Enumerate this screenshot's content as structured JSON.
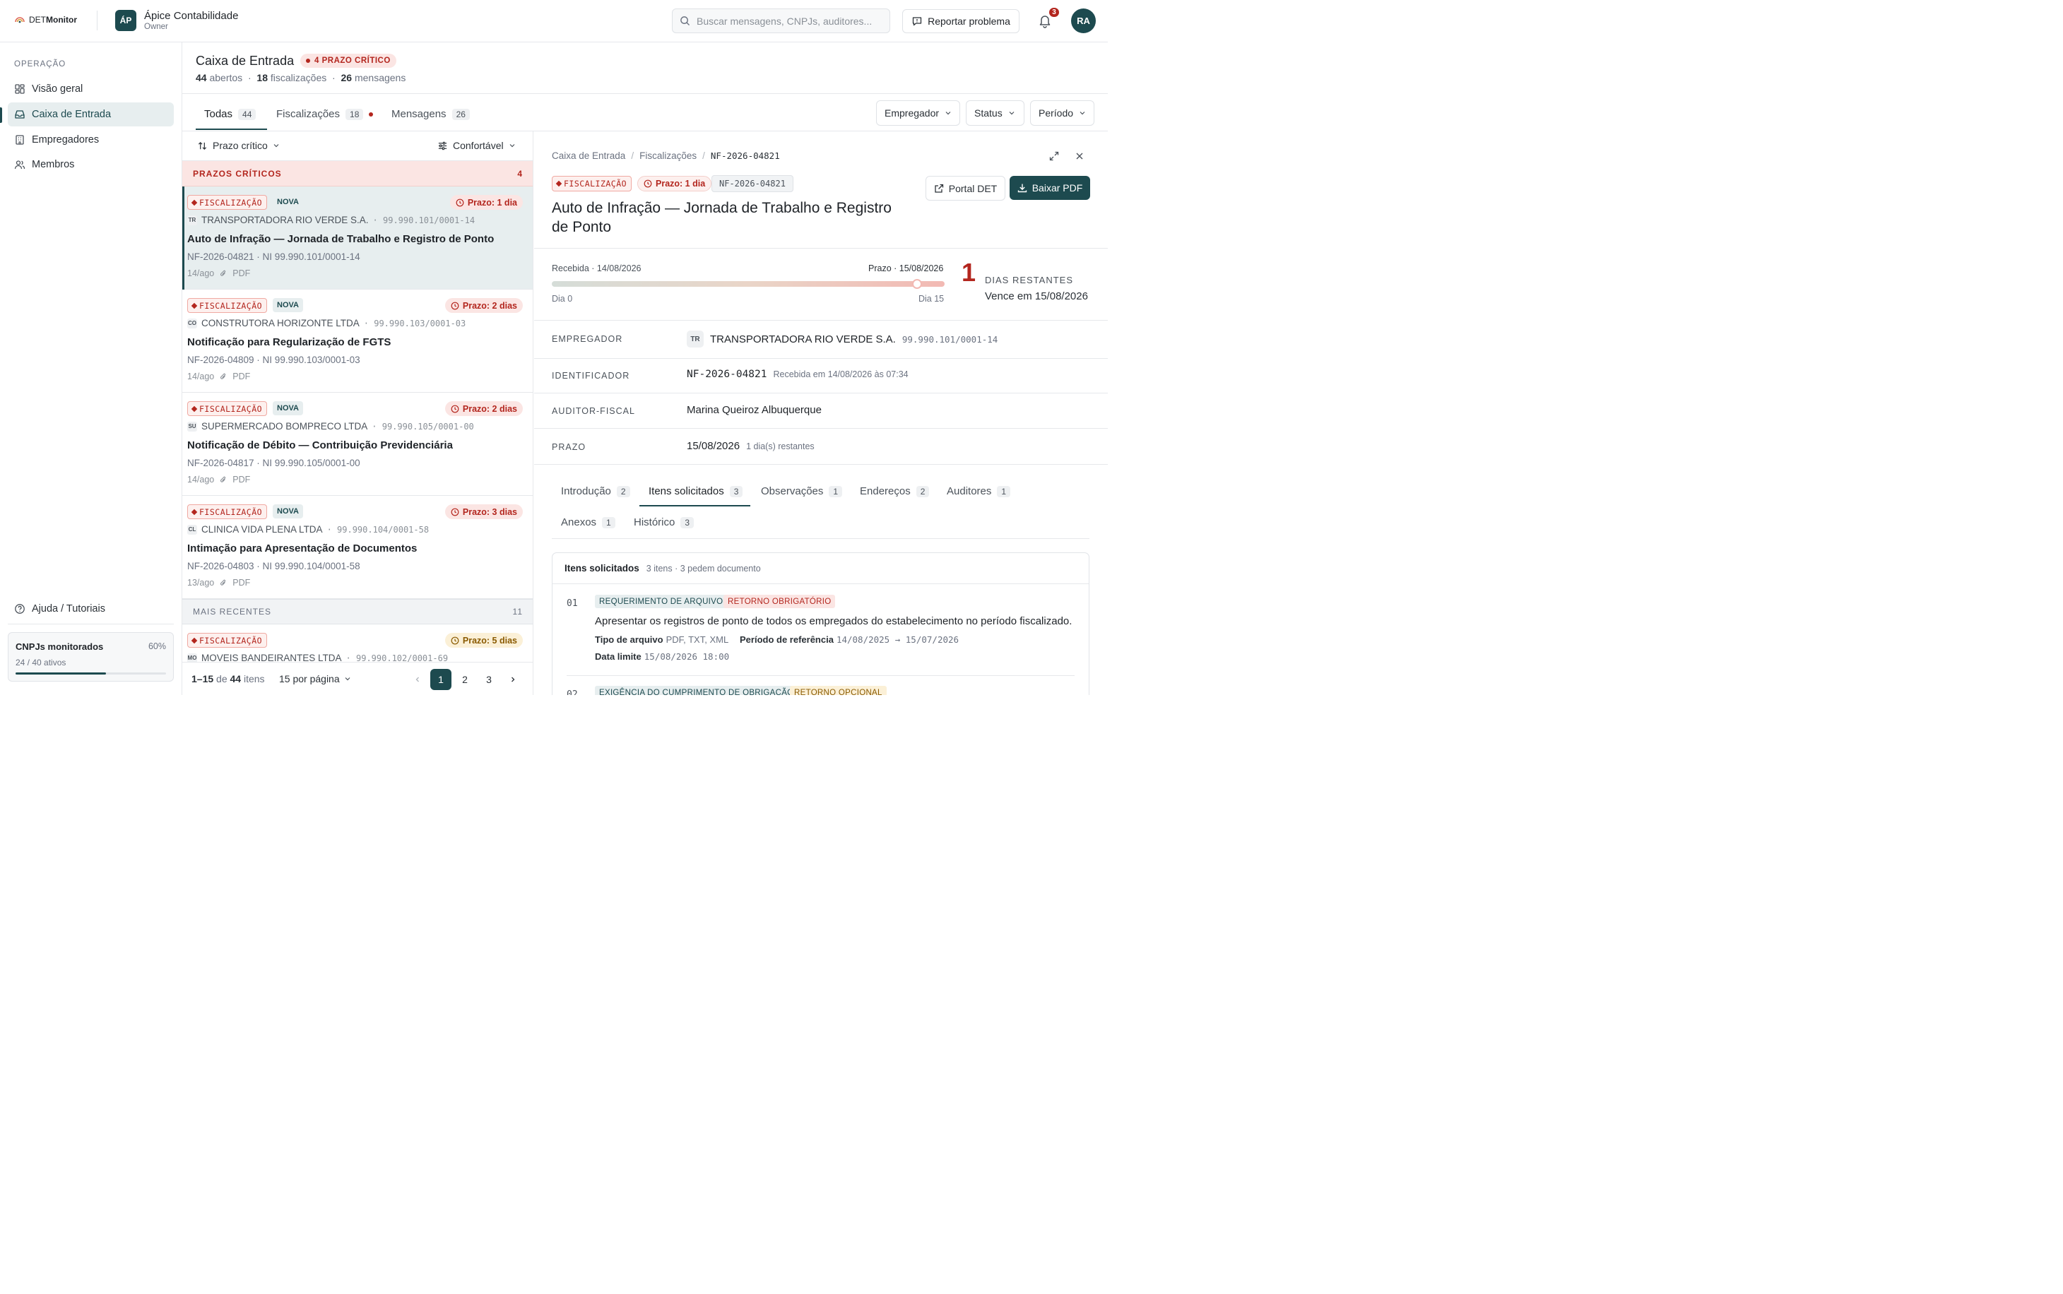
{
  "colors": {
    "brand": "#1d4a4f",
    "danger": "#b3261e",
    "warning": "#8a5a00"
  },
  "app": {
    "logo_light": "DET",
    "logo_bold": "Monitor"
  },
  "org": {
    "initials": "ÁP",
    "name": "Ápice Contabilidade",
    "role": "Owner"
  },
  "search": {
    "placeholder": "Buscar mensagens, CNPJs, auditores..."
  },
  "report_label": "Reportar problema",
  "notifications": {
    "count": "3"
  },
  "user": {
    "initials": "RA"
  },
  "sidebar": {
    "section": "OPERAÇÃO",
    "items": [
      {
        "label": "Visão geral",
        "icon": "grid-icon"
      },
      {
        "label": "Caixa de Entrada",
        "icon": "inbox-icon"
      },
      {
        "label": "Empregadores",
        "icon": "building-icon"
      },
      {
        "label": "Membros",
        "icon": "users-icon"
      }
    ],
    "help": "Ajuda / Tutoriais",
    "cnpj": {
      "title": "CNPJs monitorados",
      "pct": "60%",
      "sub": "24 / 40 ativos",
      "progress": 0.6
    }
  },
  "page": {
    "title": "Caixa de Entrada",
    "crit_badge": "4 PRAZO CRÍTICO",
    "stats": [
      {
        "value": "44",
        "label": "abertos"
      },
      {
        "value": "18",
        "label": "fiscalizações"
      },
      {
        "value": "26",
        "label": "mensagens"
      }
    ],
    "sep": "·"
  },
  "tabs": [
    {
      "label": "Todas",
      "count": "44"
    },
    {
      "label": "Fiscalizações",
      "count": "18"
    },
    {
      "label": "Mensagens",
      "count": "26"
    }
  ],
  "filters": [
    "Empregador",
    "Status",
    "Período"
  ],
  "list": {
    "sort_label": "Prazo crítico",
    "density_label": "Confortável",
    "critical_header": "PRAZOS CRÍTICOS",
    "critical_count": "4",
    "recent_header": "MAIS RECENTES",
    "recent_count": "11",
    "type_label": "FISCALIZAÇÃO",
    "new_label": "NOVA",
    "attach_label": "PDF",
    "items": [
      {
        "emp_initials": "TR",
        "employer": "TRANSPORTADORA RIO VERDE S.A.",
        "cnpj": "· 99.990.101/0001-14",
        "deadline": "Prazo: 1 dia",
        "title": "Auto de Infração — Jornada de Trabalho e Registro de Ponto",
        "ref": "NF-2026-04821 · NI 99.990.101/0001-14",
        "date": "14/ago"
      },
      {
        "emp_initials": "CO",
        "employer": "CONSTRUTORA HORIZONTE LTDA",
        "cnpj": "· 99.990.103/0001-03",
        "deadline": "Prazo: 2 dias",
        "title": "Notificação para Regularização de FGTS",
        "ref": "NF-2026-04809 · NI 99.990.103/0001-03",
        "date": "14/ago"
      },
      {
        "emp_initials": "SU",
        "employer": "SUPERMERCADO BOMPRECO LTDA",
        "cnpj": "· 99.990.105/0001-00",
        "deadline": "Prazo: 2 dias",
        "title": "Notificação de Débito — Contribuição Previdenciária",
        "ref": "NF-2026-04817 · NI 99.990.105/0001-00",
        "date": "14/ago"
      },
      {
        "emp_initials": "CL",
        "employer": "CLINICA VIDA PLENA LTDA",
        "cnpj": "· 99.990.104/0001-58",
        "deadline": "Prazo: 3 dias",
        "title": "Intimação para Apresentação de Documentos",
        "ref": "NF-2026-04803 · NI 99.990.104/0001-58",
        "date": "13/ago"
      }
    ],
    "recent_item": {
      "emp_initials": "MO",
      "employer": "MOVEIS BANDEIRANTES LTDA",
      "cnpj": "· 99.990.102/0001-69",
      "deadline": "Prazo: 5 dias"
    }
  },
  "pager": {
    "range": "1–15",
    "of": "de",
    "total": "44",
    "unit": "itens",
    "per_page": "15 por página",
    "pages": [
      "1",
      "2",
      "3"
    ]
  },
  "detail": {
    "crumbs": [
      "Caixa de Entrada",
      "Fiscalizações",
      "NF-2026-04821"
    ],
    "crumb_sep": "/",
    "type_label": "FISCALIZAÇÃO",
    "deadline": "Prazo: 1 dia",
    "id": "NF-2026-04821",
    "title": "Auto de Infração — Jornada de Trabalho e Registro de Ponto",
    "portal_label": "Portal DET",
    "pdf_label": "Baixar PDF",
    "timeline": {
      "received": "Recebida · 14/08/2026",
      "due": "Prazo · 15/08/2026",
      "start": "Dia 0",
      "end": "Dia 15",
      "progress": 0.93
    },
    "days_num": "1",
    "days_label": "DIAS RESTANTES",
    "due_text": "Vence em 15/08/2026",
    "fields": {
      "employer_label": "EMPREGADOR",
      "emp_initials": "TR",
      "employer": "TRANSPORTADORA RIO VERDE S.A.",
      "employer_cnpj": "99.990.101/0001-14",
      "id_label": "IDENTIFICADOR",
      "id": "NF-2026-04821",
      "id_sub": "Recebida em 14/08/2026 às 07:34",
      "auditor_label": "AUDITOR-FISCAL",
      "auditor": "Marina Queiroz Albuquerque",
      "deadline_label": "PRAZO",
      "deadline": "15/08/2026",
      "deadline_sub": "1 dia(s) restantes"
    },
    "subtabs": [
      {
        "label": "Introdução",
        "count": "2"
      },
      {
        "label": "Itens solicitados",
        "count": "3"
      },
      {
        "label": "Observações",
        "count": "1"
      },
      {
        "label": "Endereços",
        "count": "2"
      },
      {
        "label": "Auditores",
        "count": "1"
      },
      {
        "label": "Anexos",
        "count": "1"
      },
      {
        "label": "Histórico",
        "count": "3"
      }
    ],
    "items_card": {
      "title": "Itens solicitados",
      "sub": "3 itens · 3 pedem documento",
      "req1": {
        "num": "01",
        "chip1": "REQUERIMENTO DE ARQUIVO",
        "chip2": "RETORNO OBRIGATÓRIO",
        "desc": "Apresentar os registros de ponto de todos os empregados do estabelecimento no período fiscalizado.",
        "type_label": "Tipo de arquivo",
        "type": "PDF, TXT, XML",
        "period_label": "Período de referência",
        "period": "14/08/2025 → 15/07/2026",
        "limit_label": "Data limite",
        "limit": "15/08/2026 18:00"
      },
      "req2": {
        "num": "02",
        "chip1": "EXIGÊNCIA DO CUMPRIMENTO DE OBRIGAÇÃO",
        "chip2": "RETORNO OPCIONAL"
      }
    }
  }
}
